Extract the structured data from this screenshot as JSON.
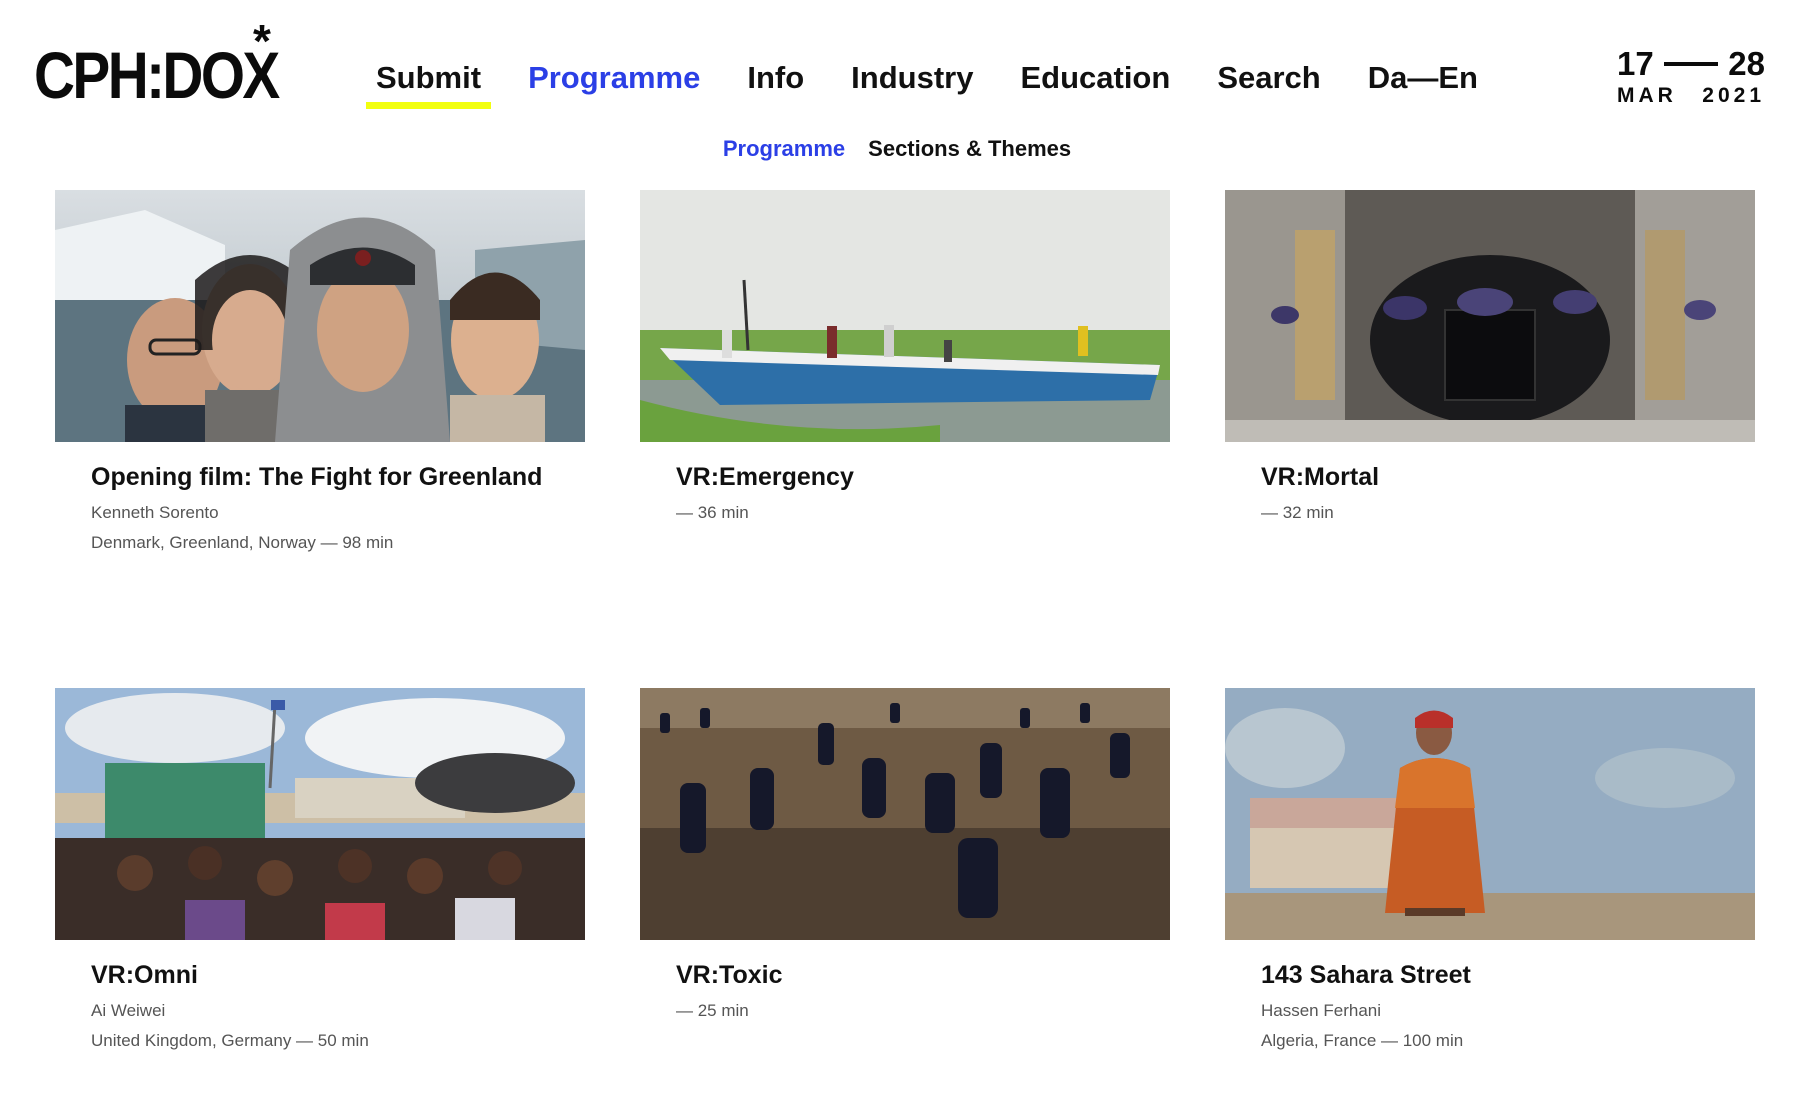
{
  "header": {
    "logo": "CPH:DOX",
    "logo_mark": "*",
    "nav": [
      {
        "label": "Submit"
      },
      {
        "label": "Programme"
      },
      {
        "label": "Info"
      },
      {
        "label": "Industry"
      },
      {
        "label": "Education"
      },
      {
        "label": "Search"
      },
      {
        "label": "Da—En"
      }
    ],
    "dates": {
      "start_day": "17",
      "end_day": "28",
      "month": "MAR",
      "year": "2021"
    }
  },
  "subnav": [
    {
      "label": "Programme"
    },
    {
      "label": "Sections & Themes"
    }
  ],
  "colors": {
    "accent_blue": "#2b3fe6",
    "highlight_yellow": "#f2ff0f"
  },
  "films": [
    {
      "title": "Opening film: The Fight for Greenland",
      "director": "Kenneth Sorento",
      "details": "Denmark, Greenland, Norway — 98 min"
    },
    {
      "title": "VR:Emergency",
      "director": "",
      "details": "— 36 min"
    },
    {
      "title": "VR:Mortal",
      "director": "",
      "details": "— 32 min"
    },
    {
      "title": "VR:Omni",
      "director": "Ai Weiwei",
      "details": "United Kingdom, Germany — 50 min"
    },
    {
      "title": "VR:Toxic",
      "director": "",
      "details": "— 25 min"
    },
    {
      "title": "143 Sahara Street",
      "director": "Hassen Ferhani",
      "details": "Algeria, France — 100 min"
    }
  ]
}
